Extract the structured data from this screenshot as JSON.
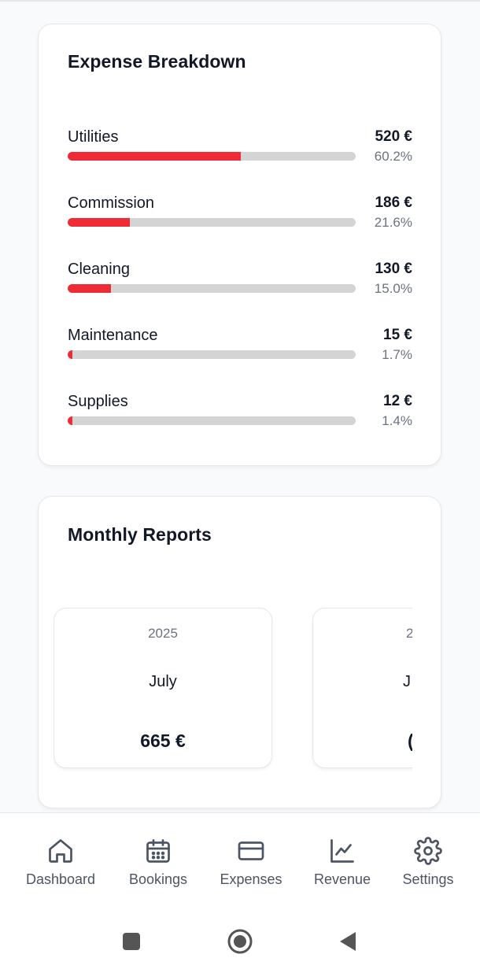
{
  "expense_breakdown": {
    "title": "Expense Breakdown",
    "items": [
      {
        "label": "Utilities",
        "amount": "520 €",
        "percent": "60.2%",
        "fraction": 0.602
      },
      {
        "label": "Commission",
        "amount": "186 €",
        "percent": "21.6%",
        "fraction": 0.216
      },
      {
        "label": "Cleaning",
        "amount": "130 €",
        "percent": "15.0%",
        "fraction": 0.15
      },
      {
        "label": "Maintenance",
        "amount": "15 €",
        "percent": "1.7%",
        "fraction": 0.017
      },
      {
        "label": "Supplies",
        "amount": "12 €",
        "percent": "1.4%",
        "fraction": 0.014
      }
    ]
  },
  "monthly_reports": {
    "title": "Monthly Reports",
    "cards": [
      {
        "year": "2025",
        "month": "July",
        "total": "665 €"
      },
      {
        "year": "2",
        "month": "J",
        "total": "("
      }
    ]
  },
  "nav": {
    "items": [
      {
        "label": "Dashboard",
        "icon": "home-icon"
      },
      {
        "label": "Bookings",
        "icon": "calendar-icon"
      },
      {
        "label": "Expenses",
        "icon": "credit-card-icon"
      },
      {
        "label": "Revenue",
        "icon": "line-chart-icon"
      },
      {
        "label": "Settings",
        "icon": "gear-icon"
      }
    ]
  },
  "system_nav": {
    "buttons": [
      "recents-square-icon",
      "home-circle-icon",
      "back-triangle-icon"
    ]
  },
  "colors": {
    "accent_bar": "#ef2b35",
    "bar_track": "#d4d4d4",
    "nav_icon": "#4b5563"
  }
}
